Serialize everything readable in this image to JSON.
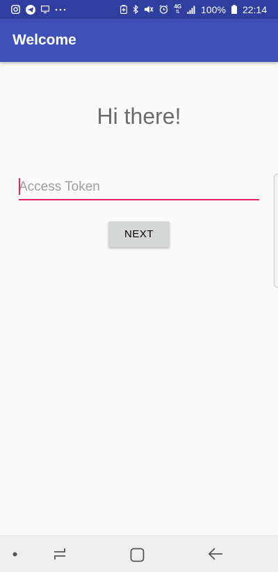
{
  "status_bar": {
    "left_icons": [
      "instagram-icon",
      "telegram-icon",
      "cast-icon",
      "more-dots-icon"
    ],
    "right_icons": [
      "battery-saver-icon",
      "bluetooth-icon",
      "mute-icon",
      "alarm-icon",
      "4g-icon",
      "signal-icon",
      "battery-icon"
    ],
    "network_label": "4G",
    "battery_percent": "100%",
    "time": "22:14"
  },
  "app_bar": {
    "title": "Welcome"
  },
  "main": {
    "heading": "Hi there!",
    "token_field": {
      "placeholder": "Access Token",
      "value": ""
    },
    "next_label": "NEXT"
  },
  "nav_bar": {
    "items": [
      "dot-icon",
      "recent-apps-icon",
      "home-icon",
      "back-icon"
    ]
  },
  "colors": {
    "status_bar": "#303f9f",
    "app_bar": "#3f51b5",
    "accent": "#e91e63",
    "background": "#fafafa",
    "button": "#d6d7d7"
  }
}
